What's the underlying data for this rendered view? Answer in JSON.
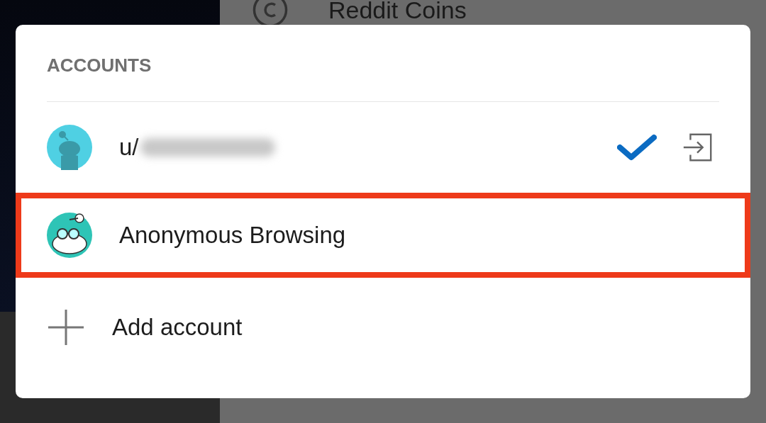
{
  "background": {
    "menu_item": "Reddit Coins"
  },
  "dialog": {
    "title": "ACCOUNTS",
    "accounts": [
      {
        "kind": "user",
        "name": "u/",
        "name_blurred": true,
        "selected": true,
        "highlighted": false
      },
      {
        "kind": "anonymous",
        "name": "Anonymous Browsing",
        "name_blurred": false,
        "selected": false,
        "highlighted": true
      }
    ],
    "add_label": "Add account"
  }
}
